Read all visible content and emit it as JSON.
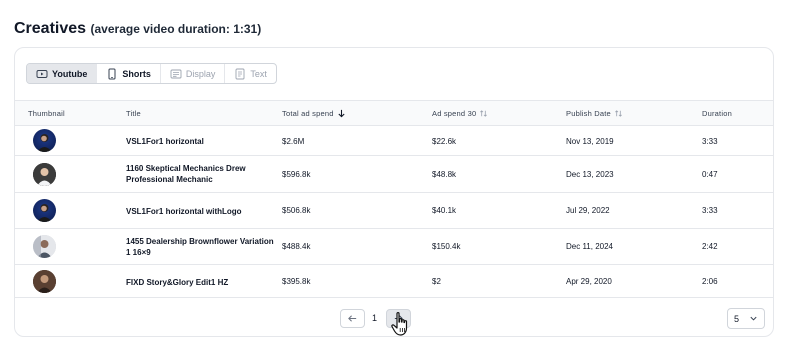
{
  "header": {
    "title": "Creatives",
    "subtitle": "(average video duration: 1:31)"
  },
  "tabs": [
    {
      "label": "Youtube",
      "icon": "youtube-icon",
      "state": "active"
    },
    {
      "label": "Shorts",
      "icon": "phone-icon",
      "state": "enabled"
    },
    {
      "label": "Display",
      "icon": "display-icon",
      "state": "disabled"
    },
    {
      "label": "Text",
      "icon": "text-doc-icon",
      "state": "disabled"
    }
  ],
  "table": {
    "columns": [
      {
        "label": "Thumbnail",
        "sort": "none"
      },
      {
        "label": "Title",
        "sort": "none"
      },
      {
        "label": "Total ad spend",
        "sort": "desc"
      },
      {
        "label": "Ad spend 30",
        "sort": "sortable"
      },
      {
        "label": "Publish Date",
        "sort": "sortable"
      },
      {
        "label": "Duration",
        "sort": "none"
      }
    ],
    "rows": [
      {
        "thumb": "blue",
        "title": "VSL1For1 horizontal",
        "total": "$2.6M",
        "spend30": "$22.6k",
        "date": "Nov 13, 2019",
        "duration": "3:33"
      },
      {
        "thumb": "dark",
        "title": "1160 Skeptical Mechanics Drew Professional Mechanic",
        "total": "$596.8k",
        "spend30": "$48.8k",
        "date": "Dec 13, 2023",
        "duration": "0:47"
      },
      {
        "thumb": "blue",
        "title": "VSL1For1 horizontal withLogo",
        "total": "$506.8k",
        "spend30": "$40.1k",
        "date": "Jul 29, 2022",
        "duration": "3:33"
      },
      {
        "thumb": "gray",
        "title": "1455 Dealership Brownflower Variation 1 16×9",
        "total": "$488.4k",
        "spend30": "$150.4k",
        "date": "Dec 11, 2024",
        "duration": "2:42"
      },
      {
        "thumb": "brown",
        "title": "FIXD Story&Glory Edit1 HZ",
        "total": "$395.8k",
        "spend30": "$2",
        "date": "Apr 29, 2020",
        "duration": "2:06"
      }
    ]
  },
  "pagination": {
    "current_page": "1",
    "page_size": "5"
  }
}
